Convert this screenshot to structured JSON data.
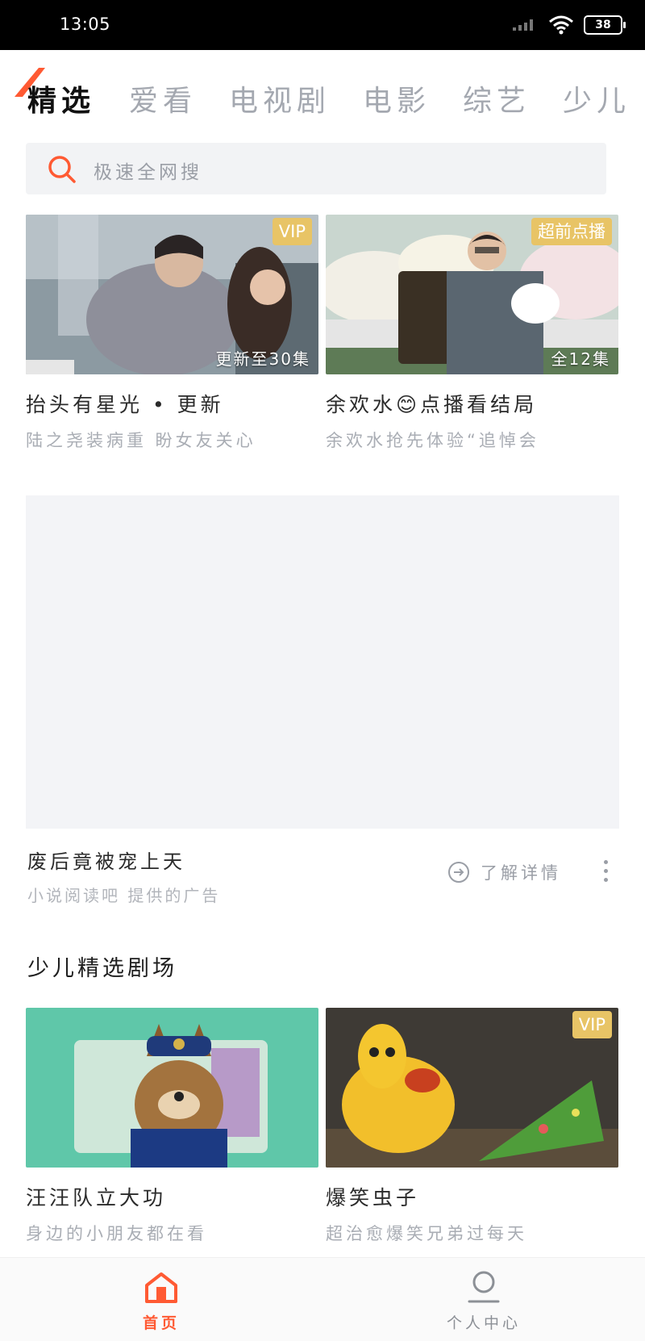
{
  "status_bar": {
    "time": "13:05",
    "battery": "38"
  },
  "tabs": [
    {
      "label": "精选",
      "active": true
    },
    {
      "label": "爱看"
    },
    {
      "label": "电视剧"
    },
    {
      "label": "电影"
    },
    {
      "label": "综艺"
    },
    {
      "label": "少儿"
    }
  ],
  "search": {
    "placeholder": "极速全网搜"
  },
  "featured": [
    {
      "badge": "VIP",
      "episode": "更新至30集",
      "title": "抬头有星光 • 更新",
      "subtitle": "陆之尧装病重 盼女友关心"
    },
    {
      "badge": "超前点播",
      "episode": "全12集",
      "title": "余欢水😊点播看结局",
      "subtitle": "余欢水抢先体验“追悼会"
    }
  ],
  "ad": {
    "title": "废后竟被宠上天",
    "source": "小说阅读吧 提供的广告",
    "detail_label": "了解详情"
  },
  "kids_section": {
    "title": "少儿精选剧场",
    "items": [
      {
        "badge": "",
        "title": "汪汪队立大功",
        "subtitle": "身边的小朋友都在看"
      },
      {
        "badge": "VIP",
        "title": "爆笑虫子",
        "subtitle": "超治愈爆笑兄弟过每天"
      }
    ]
  },
  "bottom_nav": [
    {
      "label": "首页",
      "active": true
    },
    {
      "label": "个人中心"
    }
  ],
  "colors": {
    "accent": "#ff5a33",
    "vip_badge": "#e8c466"
  }
}
